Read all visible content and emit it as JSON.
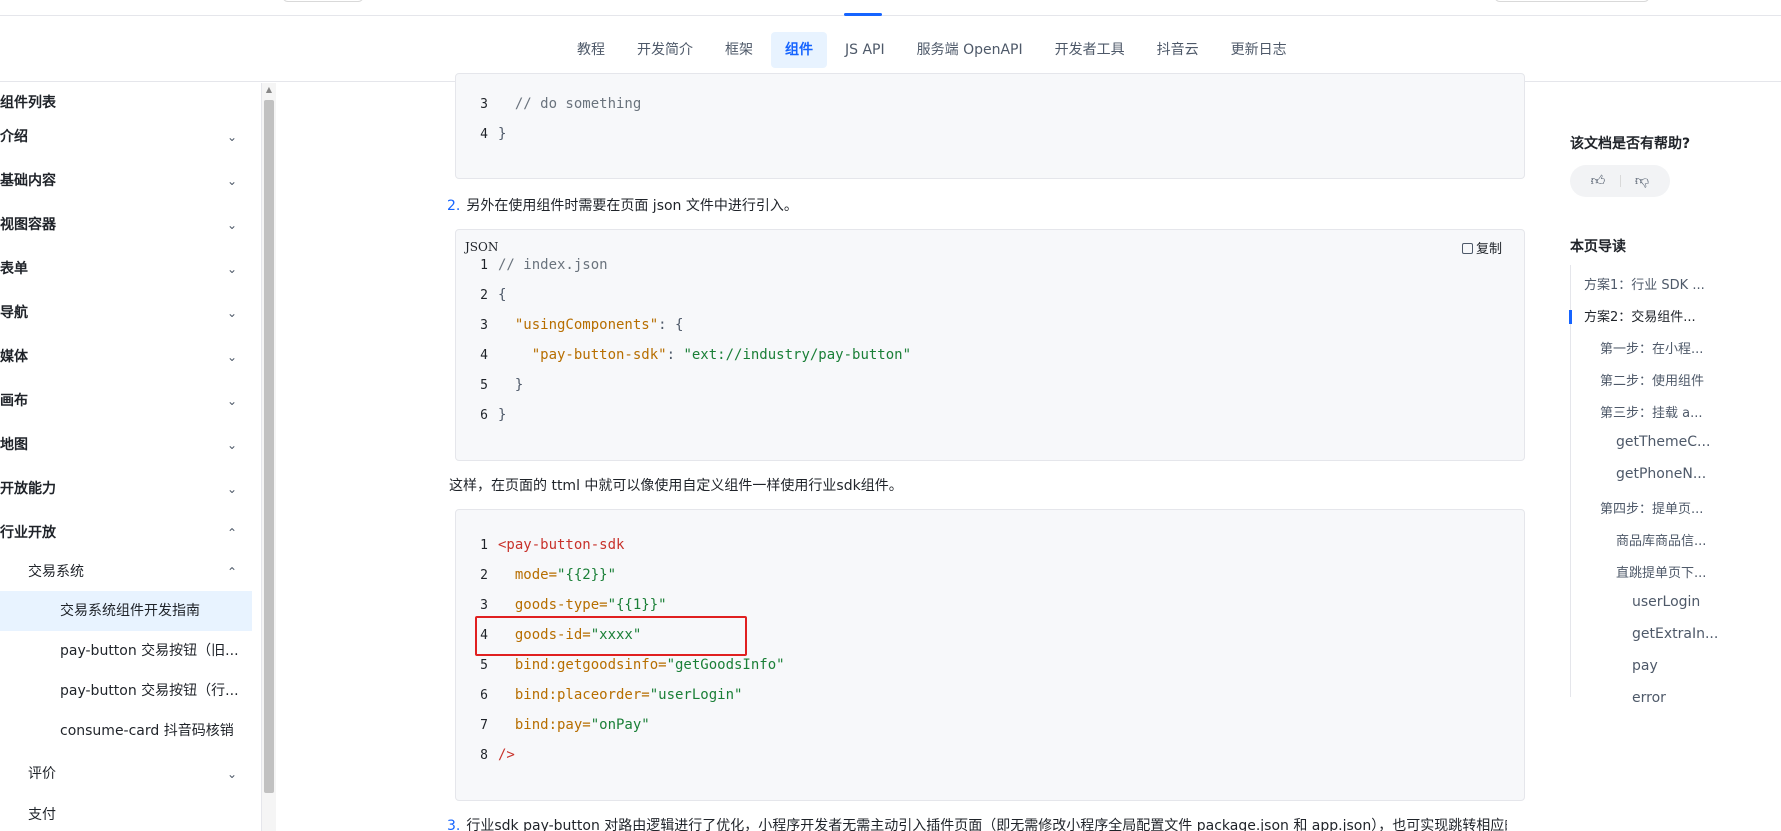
{
  "nav": {
    "items": [
      "教程",
      "开发简介",
      "框架",
      "组件",
      "JS API",
      "服务端 OpenAPI",
      "开发者工具",
      "抖音云",
      "更新日志"
    ],
    "active_index": 3
  },
  "sidebar": {
    "title": "组件列表",
    "items": [
      "介绍",
      "基础内容",
      "视图容器",
      "表单",
      "导航",
      "媒体",
      "画布",
      "地图",
      "开放能力",
      "行业开放"
    ],
    "sub_expanded": "交易系统",
    "leaves": [
      "交易系统组件开发指南",
      "pay-button 交易按钮（旧...",
      "pay-button 交易按钮（行...",
      "consume-card 抖音码核销"
    ],
    "sub_next": "评价",
    "sub_cut": "支付"
  },
  "main": {
    "code1": {
      "lines": [
        {
          "n": "3",
          "text": "  // do something"
        },
        {
          "n": "4",
          "text": "}"
        }
      ]
    },
    "step2": {
      "num": "2.",
      "text": "另外在使用组件时需要在页面 json 文件中进行引入。"
    },
    "code2": {
      "lang": "JSON",
      "copy_label": "复制",
      "l1": "// index.json",
      "l2": "{",
      "l3_key": "\"usingComponents\"",
      "l3_rest": ": {",
      "l4_key": "\"pay-button-sdk\"",
      "l4_sep": ": ",
      "l4_val": "\"ext://industry/pay-button\"",
      "l5": "  }",
      "l6": "}"
    },
    "para_after": "这样，在页面的 ttml 中就可以像使用自定义组件一样使用行业sdk组件。",
    "code3": {
      "l1": "<pay-button-sdk",
      "l2_attr": "mode=",
      "l2_val": "\"{{2}}\"",
      "l3_attr": "goods-type=",
      "l3_val": "\"{{1}}\"",
      "l4_attr": "goods-id=",
      "l4_val": "\"xxxx\"",
      "l5_attr": "bind:getgoodsinfo=",
      "l5_val": "\"getGoodsInfo\"",
      "l6_attr": "bind:placeorder=",
      "l6_val": "\"userLogin\"",
      "l7_attr": "bind:pay=",
      "l7_val": "\"onPay\"",
      "l8": "/>"
    },
    "step3": {
      "num": "3.",
      "text": "行业sdk pay-button 对路由逻辑进行了优化，小程序开发者无需主动引入插件页面（即无需修改小程序全局配置文件 package.json 和 app.json），也可实现跳转相应的页"
    }
  },
  "toc": {
    "help_title": "该文档是否有帮助?",
    "title": "本页导读",
    "items": [
      {
        "text": "方案1：行业 SDK ...",
        "level": 1
      },
      {
        "text": "方案2：交易组件...",
        "level": 1
      },
      {
        "text": "第一步：在小程...",
        "level": 2
      },
      {
        "text": "第二步：使用组件",
        "level": 2
      },
      {
        "text": "第三步：挂载 a...",
        "level": 2
      },
      {
        "text": "getThemeC...",
        "level": 3
      },
      {
        "text": "getPhoneN...",
        "level": 3
      },
      {
        "text": "第四步：提单页...",
        "level": 2
      },
      {
        "text": "商品库商品信...",
        "level": 3
      },
      {
        "text": "直跳提单页下...",
        "level": 3
      },
      {
        "text": "userLogin",
        "level": 4
      },
      {
        "text": "getExtraIn...",
        "level": 4
      },
      {
        "text": "pay",
        "level": 4
      },
      {
        "text": "error",
        "level": 4
      }
    ]
  }
}
